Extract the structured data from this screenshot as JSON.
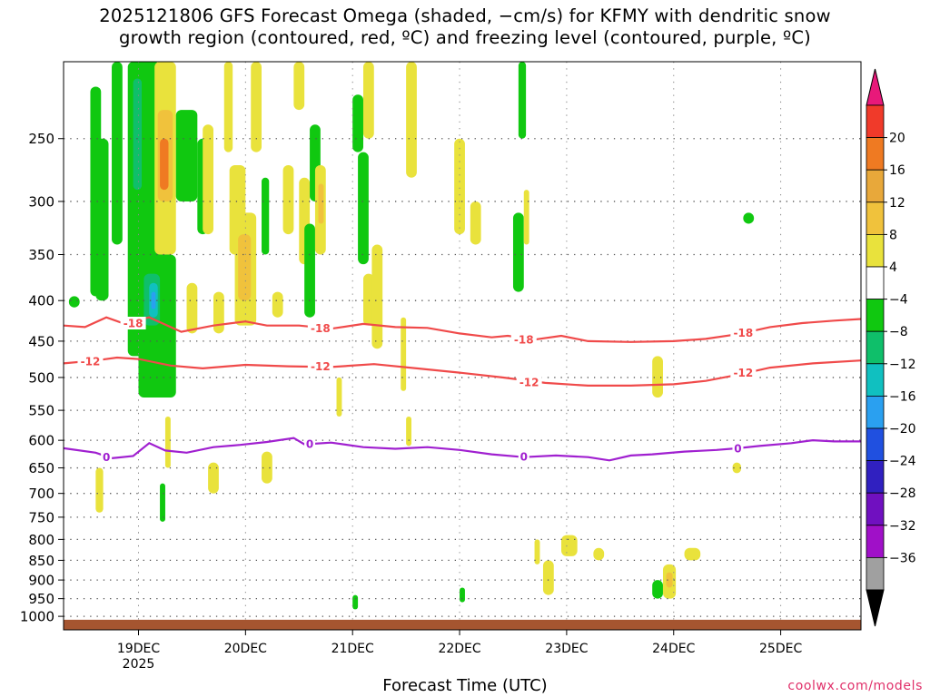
{
  "title_line1": "2025121806 GFS Forecast Omega (shaded, −cm/s) for KFMY with dendritic snow",
  "title_line2": "growth region (contoured, red, ºC) and freezing level (contoured, purple, ºC)",
  "credit": "coolwx.com/models",
  "chart_data": {
    "type": "time-height cross section",
    "xlabel": "Forecast Time (UTC)",
    "ylabel": "",
    "y_scale": "log pressure (hPa), inverted",
    "ylim": [
      1040,
      200
    ],
    "y_ticks": [
      250,
      300,
      350,
      400,
      450,
      500,
      550,
      600,
      650,
      700,
      750,
      800,
      850,
      900,
      950,
      1000
    ],
    "x_hours_range": [
      18.3,
      25.75
    ],
    "x_ticks": [
      {
        "pos": 19,
        "label": "19DEC",
        "sub": "2025"
      },
      {
        "pos": 20,
        "label": "20DEC",
        "sub": ""
      },
      {
        "pos": 21,
        "label": "21DEC",
        "sub": ""
      },
      {
        "pos": 22,
        "label": "22DEC",
        "sub": ""
      },
      {
        "pos": 23,
        "label": "23DEC",
        "sub": ""
      },
      {
        "pos": 24,
        "label": "24DEC",
        "sub": ""
      },
      {
        "pos": 25,
        "label": "25DEC",
        "sub": ""
      }
    ],
    "grid": "dotted",
    "colorbar": {
      "labels": [
        "20",
        "16",
        "12",
        "8",
        "4",
        "−4",
        "−8",
        "−12",
        "−16",
        "−20",
        "−24",
        "−28",
        "−32",
        "−36"
      ],
      "colors_top_to_bottom": [
        "#e8197a",
        "#f03a2a",
        "#ef7a22",
        "#e8a83a",
        "#f0c23c",
        "#e9e23c",
        "#ffffff",
        "#10c810",
        "#0fbf6a",
        "#10c0c0",
        "#2aa0f0",
        "#2050e0",
        "#3020c0",
        "#7010c0",
        "#a010c8",
        "#a0a0a0",
        "#000000"
      ]
    },
    "contours": [
      {
        "label": "-18",
        "color": "#f04a4a",
        "points": [
          [
            18.3,
            430
          ],
          [
            18.5,
            432
          ],
          [
            18.7,
            420
          ],
          [
            18.85,
            427
          ],
          [
            19.1,
            420
          ],
          [
            19.4,
            438
          ],
          [
            19.7,
            430
          ],
          [
            20.0,
            425
          ],
          [
            20.2,
            430
          ],
          [
            20.5,
            430
          ],
          [
            20.8,
            434
          ],
          [
            21.1,
            428
          ],
          [
            21.4,
            432
          ],
          [
            21.7,
            433
          ],
          [
            22.0,
            440
          ],
          [
            22.3,
            445
          ],
          [
            22.45,
            443
          ],
          [
            22.7,
            448
          ],
          [
            22.95,
            443
          ],
          [
            23.2,
            450
          ],
          [
            23.6,
            451
          ],
          [
            24.0,
            450
          ],
          [
            24.3,
            447
          ],
          [
            24.6,
            441
          ],
          [
            24.9,
            432
          ],
          [
            25.2,
            427
          ],
          [
            25.5,
            424
          ],
          [
            25.75,
            422
          ]
        ],
        "label_at": [
          [
            18.95,
            427
          ],
          [
            20.7,
            433
          ],
          [
            22.6,
            448
          ],
          [
            24.65,
            439
          ]
        ]
      },
      {
        "label": "-12",
        "color": "#f04a4a",
        "points": [
          [
            18.3,
            480
          ],
          [
            18.6,
            476
          ],
          [
            18.8,
            472
          ],
          [
            19.0,
            474
          ],
          [
            19.3,
            483
          ],
          [
            19.6,
            487
          ],
          [
            20.0,
            482
          ],
          [
            20.4,
            484
          ],
          [
            20.8,
            485
          ],
          [
            21.2,
            481
          ],
          [
            21.6,
            487
          ],
          [
            22.0,
            493
          ],
          [
            22.4,
            500
          ],
          [
            22.8,
            508
          ],
          [
            23.2,
            512
          ],
          [
            23.6,
            512
          ],
          [
            24.0,
            510
          ],
          [
            24.3,
            505
          ],
          [
            24.6,
            496
          ],
          [
            24.9,
            486
          ],
          [
            25.3,
            480
          ],
          [
            25.75,
            476
          ]
        ],
        "label_at": [
          [
            18.55,
            477
          ],
          [
            20.7,
            484
          ],
          [
            22.65,
            507
          ],
          [
            24.65,
            493
          ]
        ]
      },
      {
        "label": "0",
        "color": "#a020d0",
        "points": [
          [
            18.3,
            614
          ],
          [
            18.6,
            622
          ],
          [
            18.75,
            632
          ],
          [
            18.95,
            628
          ],
          [
            19.1,
            605
          ],
          [
            19.25,
            618
          ],
          [
            19.45,
            622
          ],
          [
            19.7,
            612
          ],
          [
            19.95,
            608
          ],
          [
            20.2,
            603
          ],
          [
            20.45,
            596
          ],
          [
            20.55,
            607
          ],
          [
            20.8,
            604
          ],
          [
            21.1,
            612
          ],
          [
            21.4,
            615
          ],
          [
            21.7,
            612
          ],
          [
            22.0,
            617
          ],
          [
            22.3,
            625
          ],
          [
            22.6,
            630
          ],
          [
            22.9,
            627
          ],
          [
            23.2,
            630
          ],
          [
            23.4,
            636
          ],
          [
            23.6,
            627
          ],
          [
            23.8,
            625
          ],
          [
            24.1,
            620
          ],
          [
            24.4,
            617
          ],
          [
            24.6,
            614
          ],
          [
            24.8,
            610
          ],
          [
            25.1,
            605
          ],
          [
            25.3,
            600
          ],
          [
            25.5,
            602
          ],
          [
            25.75,
            602
          ]
        ],
        "label_at": [
          [
            18.7,
            630
          ],
          [
            20.6,
            606
          ],
          [
            22.6,
            629
          ],
          [
            24.6,
            614
          ]
        ]
      }
    ],
    "omega_regions": [
      {
        "x": [
          18.35,
          18.45
        ],
        "p": [
          395,
          408
        ],
        "c": "#10c810"
      },
      {
        "x": [
          18.55,
          18.65
        ],
        "p": [
          215,
          395
        ],
        "c": "#10c810"
      },
      {
        "x": [
          18.6,
          18.67
        ],
        "p": [
          650,
          740
        ],
        "c": "#e9e23c"
      },
      {
        "x": [
          18.6,
          18.72
        ],
        "p": [
          250,
          400
        ],
        "c": "#10c810"
      },
      {
        "x": [
          18.75,
          18.85
        ],
        "p": [
          200,
          340
        ],
        "c": "#10c810"
      },
      {
        "x": [
          18.9,
          19.2
        ],
        "p": [
          200,
          470
        ],
        "c": "#10c810"
      },
      {
        "x": [
          18.95,
          19.03
        ],
        "p": [
          210,
          290
        ],
        "c": "#0fbf6a"
      },
      {
        "x": [
          19.0,
          19.35
        ],
        "p": [
          350,
          530
        ],
        "c": "#10c810"
      },
      {
        "x": [
          19.05,
          19.2
        ],
        "p": [
          370,
          430
        ],
        "c": "#0fbf6a"
      },
      {
        "x": [
          19.1,
          19.18
        ],
        "p": [
          380,
          420
        ],
        "c": "#10c0c0"
      },
      {
        "x": [
          19.12,
          19.16
        ],
        "p": [
          390,
          410
        ],
        "c": "#2aa0f0"
      },
      {
        "x": [
          19.15,
          19.35
        ],
        "p": [
          200,
          350
        ],
        "c": "#e9e23c"
      },
      {
        "x": [
          19.18,
          19.32
        ],
        "p": [
          230,
          300
        ],
        "c": "#f0c23c"
      },
      {
        "x": [
          19.2,
          19.28
        ],
        "p": [
          250,
          290
        ],
        "c": "#ef7a22"
      },
      {
        "x": [
          19.35,
          19.55
        ],
        "p": [
          230,
          300
        ],
        "c": "#10c810"
      },
      {
        "x": [
          19.45,
          19.55
        ],
        "p": [
          380,
          440
        ],
        "c": "#e9e23c"
      },
      {
        "x": [
          19.55,
          19.65
        ],
        "p": [
          250,
          330
        ],
        "c": "#10c810"
      },
      {
        "x": [
          19.6,
          19.7
        ],
        "p": [
          240,
          330
        ],
        "c": "#e9e23c"
      },
      {
        "x": [
          19.7,
          19.8
        ],
        "p": [
          390,
          440
        ],
        "c": "#e9e23c"
      },
      {
        "x": [
          19.65,
          19.75
        ],
        "p": [
          640,
          700
        ],
        "c": "#e9e23c"
      },
      {
        "x": [
          19.8,
          19.88
        ],
        "p": [
          200,
          260
        ],
        "c": "#e9e23c"
      },
      {
        "x": [
          19.85,
          20.0
        ],
        "p": [
          270,
          350
        ],
        "c": "#e9e23c"
      },
      {
        "x": [
          19.9,
          20.1
        ],
        "p": [
          310,
          430
        ],
        "c": "#e9e23c"
      },
      {
        "x": [
          19.93,
          20.05
        ],
        "p": [
          330,
          400
        ],
        "c": "#f0c23c"
      },
      {
        "x": [
          20.05,
          20.15
        ],
        "p": [
          200,
          260
        ],
        "c": "#e9e23c"
      },
      {
        "x": [
          20.15,
          20.22
        ],
        "p": [
          280,
          350
        ],
        "c": "#10c810"
      },
      {
        "x": [
          20.15,
          20.25
        ],
        "p": [
          620,
          680
        ],
        "c": "#e9e23c"
      },
      {
        "x": [
          20.25,
          20.35
        ],
        "p": [
          390,
          420
        ],
        "c": "#e9e23c"
      },
      {
        "x": [
          20.35,
          20.45
        ],
        "p": [
          270,
          330
        ],
        "c": "#e9e23c"
      },
      {
        "x": [
          20.45,
          20.55
        ],
        "p": [
          200,
          230
        ],
        "c": "#e9e23c"
      },
      {
        "x": [
          20.5,
          20.6
        ],
        "p": [
          280,
          360
        ],
        "c": "#e9e23c"
      },
      {
        "x": [
          20.55,
          20.65
        ],
        "p": [
          320,
          420
        ],
        "c": "#10c810"
      },
      {
        "x": [
          20.6,
          20.7
        ],
        "p": [
          240,
          300
        ],
        "c": "#10c810"
      },
      {
        "x": [
          20.65,
          20.75
        ],
        "p": [
          270,
          350
        ],
        "c": "#e9e23c"
      },
      {
        "x": [
          20.68,
          20.73
        ],
        "p": [
          285,
          320
        ],
        "c": "#f0c23c"
      },
      {
        "x": [
          21.0,
          21.1
        ],
        "p": [
          220,
          260
        ],
        "c": "#10c810"
      },
      {
        "x": [
          21.05,
          21.15
        ],
        "p": [
          260,
          360
        ],
        "c": "#10c810"
      },
      {
        "x": [
          21.1,
          21.2
        ],
        "p": [
          370,
          430
        ],
        "c": "#e9e23c"
      },
      {
        "x": [
          21.1,
          21.2
        ],
        "p": [
          200,
          250
        ],
        "c": "#e9e23c"
      },
      {
        "x": [
          21.18,
          21.28
        ],
        "p": [
          340,
          460
        ],
        "c": "#e9e23c"
      },
      {
        "x": [
          21.5,
          21.6
        ],
        "p": [
          200,
          280
        ],
        "c": "#e9e23c"
      },
      {
        "x": [
          21.45,
          21.5
        ],
        "p": [
          420,
          520
        ],
        "c": "#e9e23c"
      },
      {
        "x": [
          21.5,
          21.55
        ],
        "p": [
          560,
          610
        ],
        "c": "#e9e23c"
      },
      {
        "x": [
          21.95,
          22.05
        ],
        "p": [
          250,
          330
        ],
        "c": "#e9e23c"
      },
      {
        "x": [
          22.1,
          22.2
        ],
        "p": [
          300,
          340
        ],
        "c": "#e9e23c"
      },
      {
        "x": [
          22.5,
          22.6
        ],
        "p": [
          310,
          390
        ],
        "c": "#10c810"
      },
      {
        "x": [
          22.6,
          22.65
        ],
        "p": [
          290,
          340
        ],
        "c": "#e9e23c"
      },
      {
        "x": [
          22.55,
          22.62
        ],
        "p": [
          200,
          250
        ],
        "c": "#10c810"
      },
      {
        "x": [
          22.7,
          22.75
        ],
        "p": [
          800,
          860
        ],
        "c": "#e9e23c"
      },
      {
        "x": [
          22.78,
          22.88
        ],
        "p": [
          850,
          940
        ],
        "c": "#e9e23c"
      },
      {
        "x": [
          22.95,
          23.1
        ],
        "p": [
          790,
          840
        ],
        "c": "#e9e23c"
      },
      {
        "x": [
          23.25,
          23.35
        ],
        "p": [
          820,
          850
        ],
        "c": "#e9e23c"
      },
      {
        "x": [
          23.8,
          23.9
        ],
        "p": [
          470,
          530
        ],
        "c": "#e9e23c"
      },
      {
        "x": [
          23.8,
          23.9
        ],
        "p": [
          900,
          950
        ],
        "c": "#10c810"
      },
      {
        "x": [
          23.9,
          24.02
        ],
        "p": [
          860,
          950
        ],
        "c": "#e9e23c"
      },
      {
        "x": [
          23.93,
          23.99
        ],
        "p": [
          880,
          920
        ],
        "c": "#f0c23c"
      },
      {
        "x": [
          24.1,
          24.25
        ],
        "p": [
          820,
          850
        ],
        "c": "#e9e23c"
      },
      {
        "x": [
          24.55,
          24.63
        ],
        "p": [
          640,
          660
        ],
        "c": "#e9e23c"
      },
      {
        "x": [
          24.65,
          24.75
        ],
        "p": [
          310,
          320
        ],
        "c": "#10c810"
      },
      {
        "x": [
          19.2,
          19.25
        ],
        "p": [
          680,
          760
        ],
        "c": "#10c810"
      },
      {
        "x": [
          19.25,
          19.3
        ],
        "p": [
          560,
          650
        ],
        "c": "#e9e23c"
      },
      {
        "x": [
          20.85,
          20.9
        ],
        "p": [
          500,
          560
        ],
        "c": "#e9e23c"
      },
      {
        "x": [
          21.0,
          21.05
        ],
        "p": [
          940,
          980
        ],
        "c": "#10c810"
      },
      {
        "x": [
          22.0,
          22.05
        ],
        "p": [
          920,
          960
        ],
        "c": "#10c810"
      }
    ]
  }
}
